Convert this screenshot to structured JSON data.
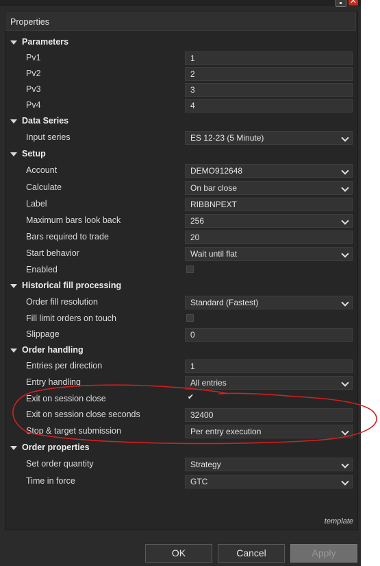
{
  "panel": {
    "title": "Properties",
    "template_label": "template"
  },
  "categories": {
    "parameters": "Parameters",
    "data_series": "Data Series",
    "setup": "Setup",
    "historical": "Historical fill processing",
    "order_handling": "Order handling",
    "order_properties": "Order properties"
  },
  "props": {
    "pv1": {
      "label": "Pv1",
      "value": "1"
    },
    "pv2": {
      "label": "Pv2",
      "value": "2"
    },
    "pv3": {
      "label": "Pv3",
      "value": "3"
    },
    "pv4": {
      "label": "Pv4",
      "value": "4"
    },
    "input_series": {
      "label": "Input series",
      "value": "ES 12-23 (5 Minute)"
    },
    "account": {
      "label": "Account",
      "value": "DEMO912648"
    },
    "calculate": {
      "label": "Calculate",
      "value": "On bar close"
    },
    "label": {
      "label": "Label",
      "value": "RIBBNPEXT"
    },
    "max_bars": {
      "label": "Maximum bars look back",
      "value": "256"
    },
    "bars_required": {
      "label": "Bars required to trade",
      "value": "20"
    },
    "start_behavior": {
      "label": "Start behavior",
      "value": "Wait until flat"
    },
    "enabled": {
      "label": "Enabled",
      "checked": false
    },
    "order_fill_res": {
      "label": "Order fill resolution",
      "value": "Standard (Fastest)"
    },
    "fill_limit": {
      "label": "Fill limit orders on touch",
      "checked": false
    },
    "slippage": {
      "label": "Slippage",
      "value": "0"
    },
    "entries_per_dir": {
      "label": "Entries per direction",
      "value": "1"
    },
    "entry_handling": {
      "label": "Entry handling",
      "value": "All entries"
    },
    "exit_session_close": {
      "label": "Exit on session close",
      "checked": true,
      "checkmark": "✔"
    },
    "exit_session_seconds": {
      "label": "Exit on session close seconds",
      "value": "32400"
    },
    "stop_target": {
      "label": "Stop & target submission",
      "value": "Per entry execution"
    },
    "order_qty": {
      "label": "Set order quantity",
      "value": "Strategy"
    },
    "tif": {
      "label": "Time in force",
      "value": "GTC"
    }
  },
  "buttons": {
    "ok": "OK",
    "cancel": "Cancel",
    "apply": "Apply"
  },
  "window_controls": {
    "close": "✕"
  },
  "colors": {
    "annotation_red": "#d42020",
    "background": "#2b2b2b",
    "field_bg": "#333333"
  }
}
